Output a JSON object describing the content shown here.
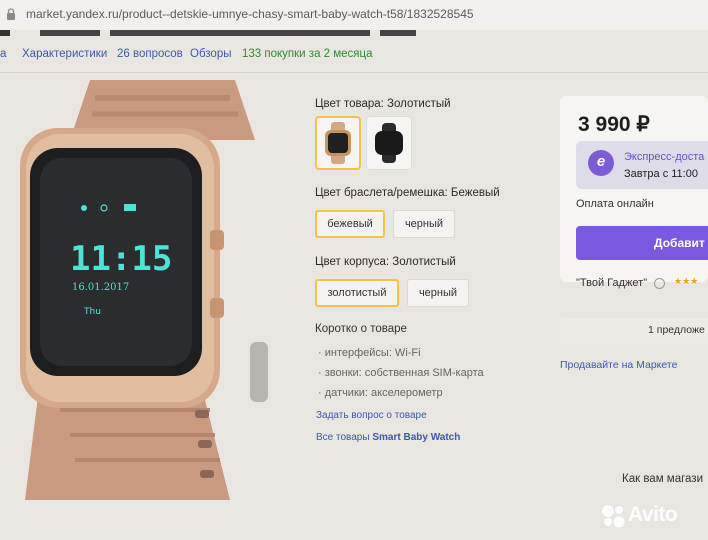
{
  "browser": {
    "url": "market.yandex.ru/product--detskie-umnye-chasy-smart-baby-watch-t58/1832528545"
  },
  "subnav": {
    "item_partial": "а",
    "specs": "Характеристики",
    "questions": "26 вопросов",
    "reviews": "Обзоры",
    "purchases": "133 покупки за 2 месяца"
  },
  "product_image": {
    "watch_time": "11:15",
    "watch_date": "16.01.2017",
    "watch_weekday": "Thu"
  },
  "options": {
    "color": {
      "label": "Цвет товара: Золотистый",
      "swatches": [
        "gold-watch",
        "black-watch"
      ],
      "selected_index": 0
    },
    "strap": {
      "label": "Цвет браслета/ремешка: Бежевый",
      "values": [
        "бежевый",
        "черный"
      ],
      "selected_index": 0
    },
    "case": {
      "label": "Цвет корпуса: Золотистый",
      "values": [
        "золотистый",
        "черный"
      ],
      "selected_index": 0
    }
  },
  "short_info": {
    "title": "Коротко о товаре",
    "bullets": [
      "интерфейсы: Wi-Fi",
      "звонки: собственная SIM-карта",
      "датчики: акселерометр"
    ],
    "ask_question": "Задать вопрос о товаре",
    "all_products_prefix": "Все товары",
    "all_products_brand": "Smart Baby Watch"
  },
  "buy_box": {
    "price": "3 990 ₽",
    "express_title": "Экспресс-доста",
    "express_icon_letter": "е",
    "express_date": "Завтра с 11:00",
    "payment": "Оплата онлайн",
    "add_button": "Добавит",
    "shop": "\"Твой Гаджет\"",
    "stars": "★★★",
    "offers": "1 предложе",
    "sell_link": "Продавайте на Маркете"
  },
  "footer": {
    "how_partial": "Как вам магази"
  },
  "watermark": {
    "text": "Avito"
  },
  "colors": {
    "accent_yellow": "#f3c24a",
    "purple": "#7a58e0",
    "link_blue": "#3d5aa8",
    "green": "#2e8b2e"
  }
}
